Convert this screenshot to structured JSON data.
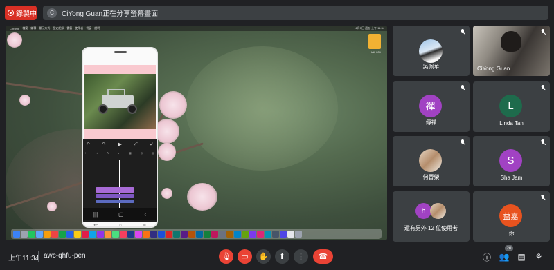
{
  "recording": {
    "label": "錄製中"
  },
  "share_banner": {
    "avatar_letter": "C",
    "text": "CiYong Guan正在分享螢幕畫面"
  },
  "presentation": {
    "menubar_items": [
      "Chrome",
      "檔案",
      "編輯",
      "顯示方式",
      "歷史記錄",
      "書籤",
      "使用者",
      "視窗",
      "說明"
    ],
    "menubar_right": "11月5日 週五 上午 11:34",
    "desktop_file_label": "Halll 004"
  },
  "participants": [
    {
      "name": "吳佩華",
      "avatar_type": "photo-penguins",
      "muted": true
    },
    {
      "name": "CiYong Guan",
      "avatar_type": "video",
      "muted": true
    },
    {
      "name": "傳禪",
      "avatar_letter": "禪",
      "avatar_color": "#a142c3",
      "muted": true
    },
    {
      "name": "Linda Tan",
      "avatar_letter": "L",
      "avatar_color": "#1e6b4c",
      "muted": true
    },
    {
      "name": "何晉榮",
      "avatar_type": "photo-person",
      "muted": true
    },
    {
      "name": "Sha Jam",
      "avatar_letter": "S",
      "avatar_color": "#a142c3",
      "muted": true
    },
    {
      "name": "還有另外 12 位使用者",
      "avatar_letter": "h",
      "avatar_color": "#a142c3"
    },
    {
      "name": "你",
      "avatar_letter": "益嘉",
      "avatar_color": "#e8531f",
      "muted": true
    }
  ],
  "bottombar": {
    "time": "上午11:34",
    "meeting_code": "awc-qhfu-pen",
    "people_count": "20"
  },
  "colors": {
    "accent_red": "#ea4335",
    "tile_bg": "#3c4043",
    "page_bg": "#202124"
  }
}
